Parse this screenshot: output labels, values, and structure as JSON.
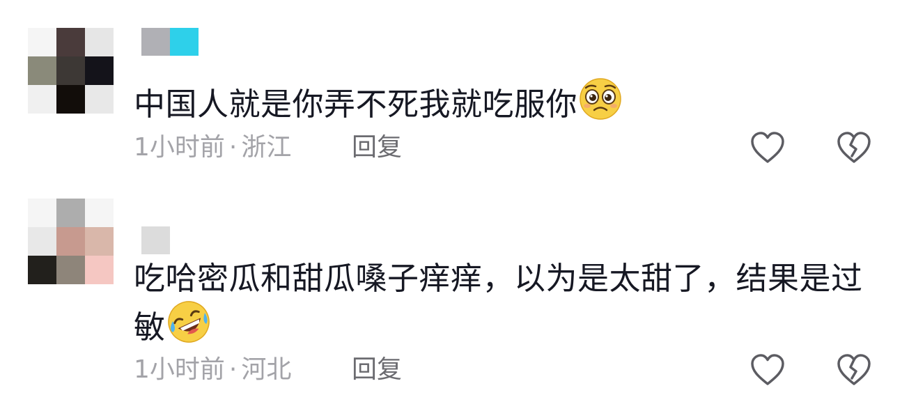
{
  "comments": [
    {
      "text": "中国人就是你弄不死我就吃服你",
      "emoji": "pleading-face-emoji",
      "time": "1小时前",
      "location": "浙江",
      "reply_label": "回复",
      "like_icon": "heart-outline-icon",
      "dislike_icon": "broken-heart-icon",
      "avatar_colors": [
        "#f5f5f5",
        "#4a3b3b",
        "#e6e6e6",
        "#8a8a7a",
        "#3d3835",
        "#14131a",
        "#f0f0f0",
        "#120d0a",
        "#e8e8e8"
      ],
      "username_colors": [
        "#b0b0b5",
        "#2ed0ea"
      ]
    },
    {
      "text": "吃哈密瓜和甜瓜嗓子痒痒，以为是太甜了，结果是过敏",
      "emoji": "rolling-laughing-emoji",
      "time": "1小时前",
      "location": "河北",
      "reply_label": "回复",
      "like_icon": "heart-outline-icon",
      "dislike_icon": "broken-heart-icon",
      "avatar_colors": [
        "#f5f5f5",
        "#adadad",
        "#f5f5f5",
        "#e8e8e8",
        "#c79a8f",
        "#d9b7aa",
        "#22201c",
        "#8e857a",
        "#f5c7c2"
      ],
      "username_colors": [
        "#dcdcdc"
      ]
    }
  ],
  "separator": "·",
  "colors": {
    "text": "#161823",
    "meta": "#a3a3a8",
    "reply": "#6b6b70",
    "icon": "#5c5c62"
  }
}
